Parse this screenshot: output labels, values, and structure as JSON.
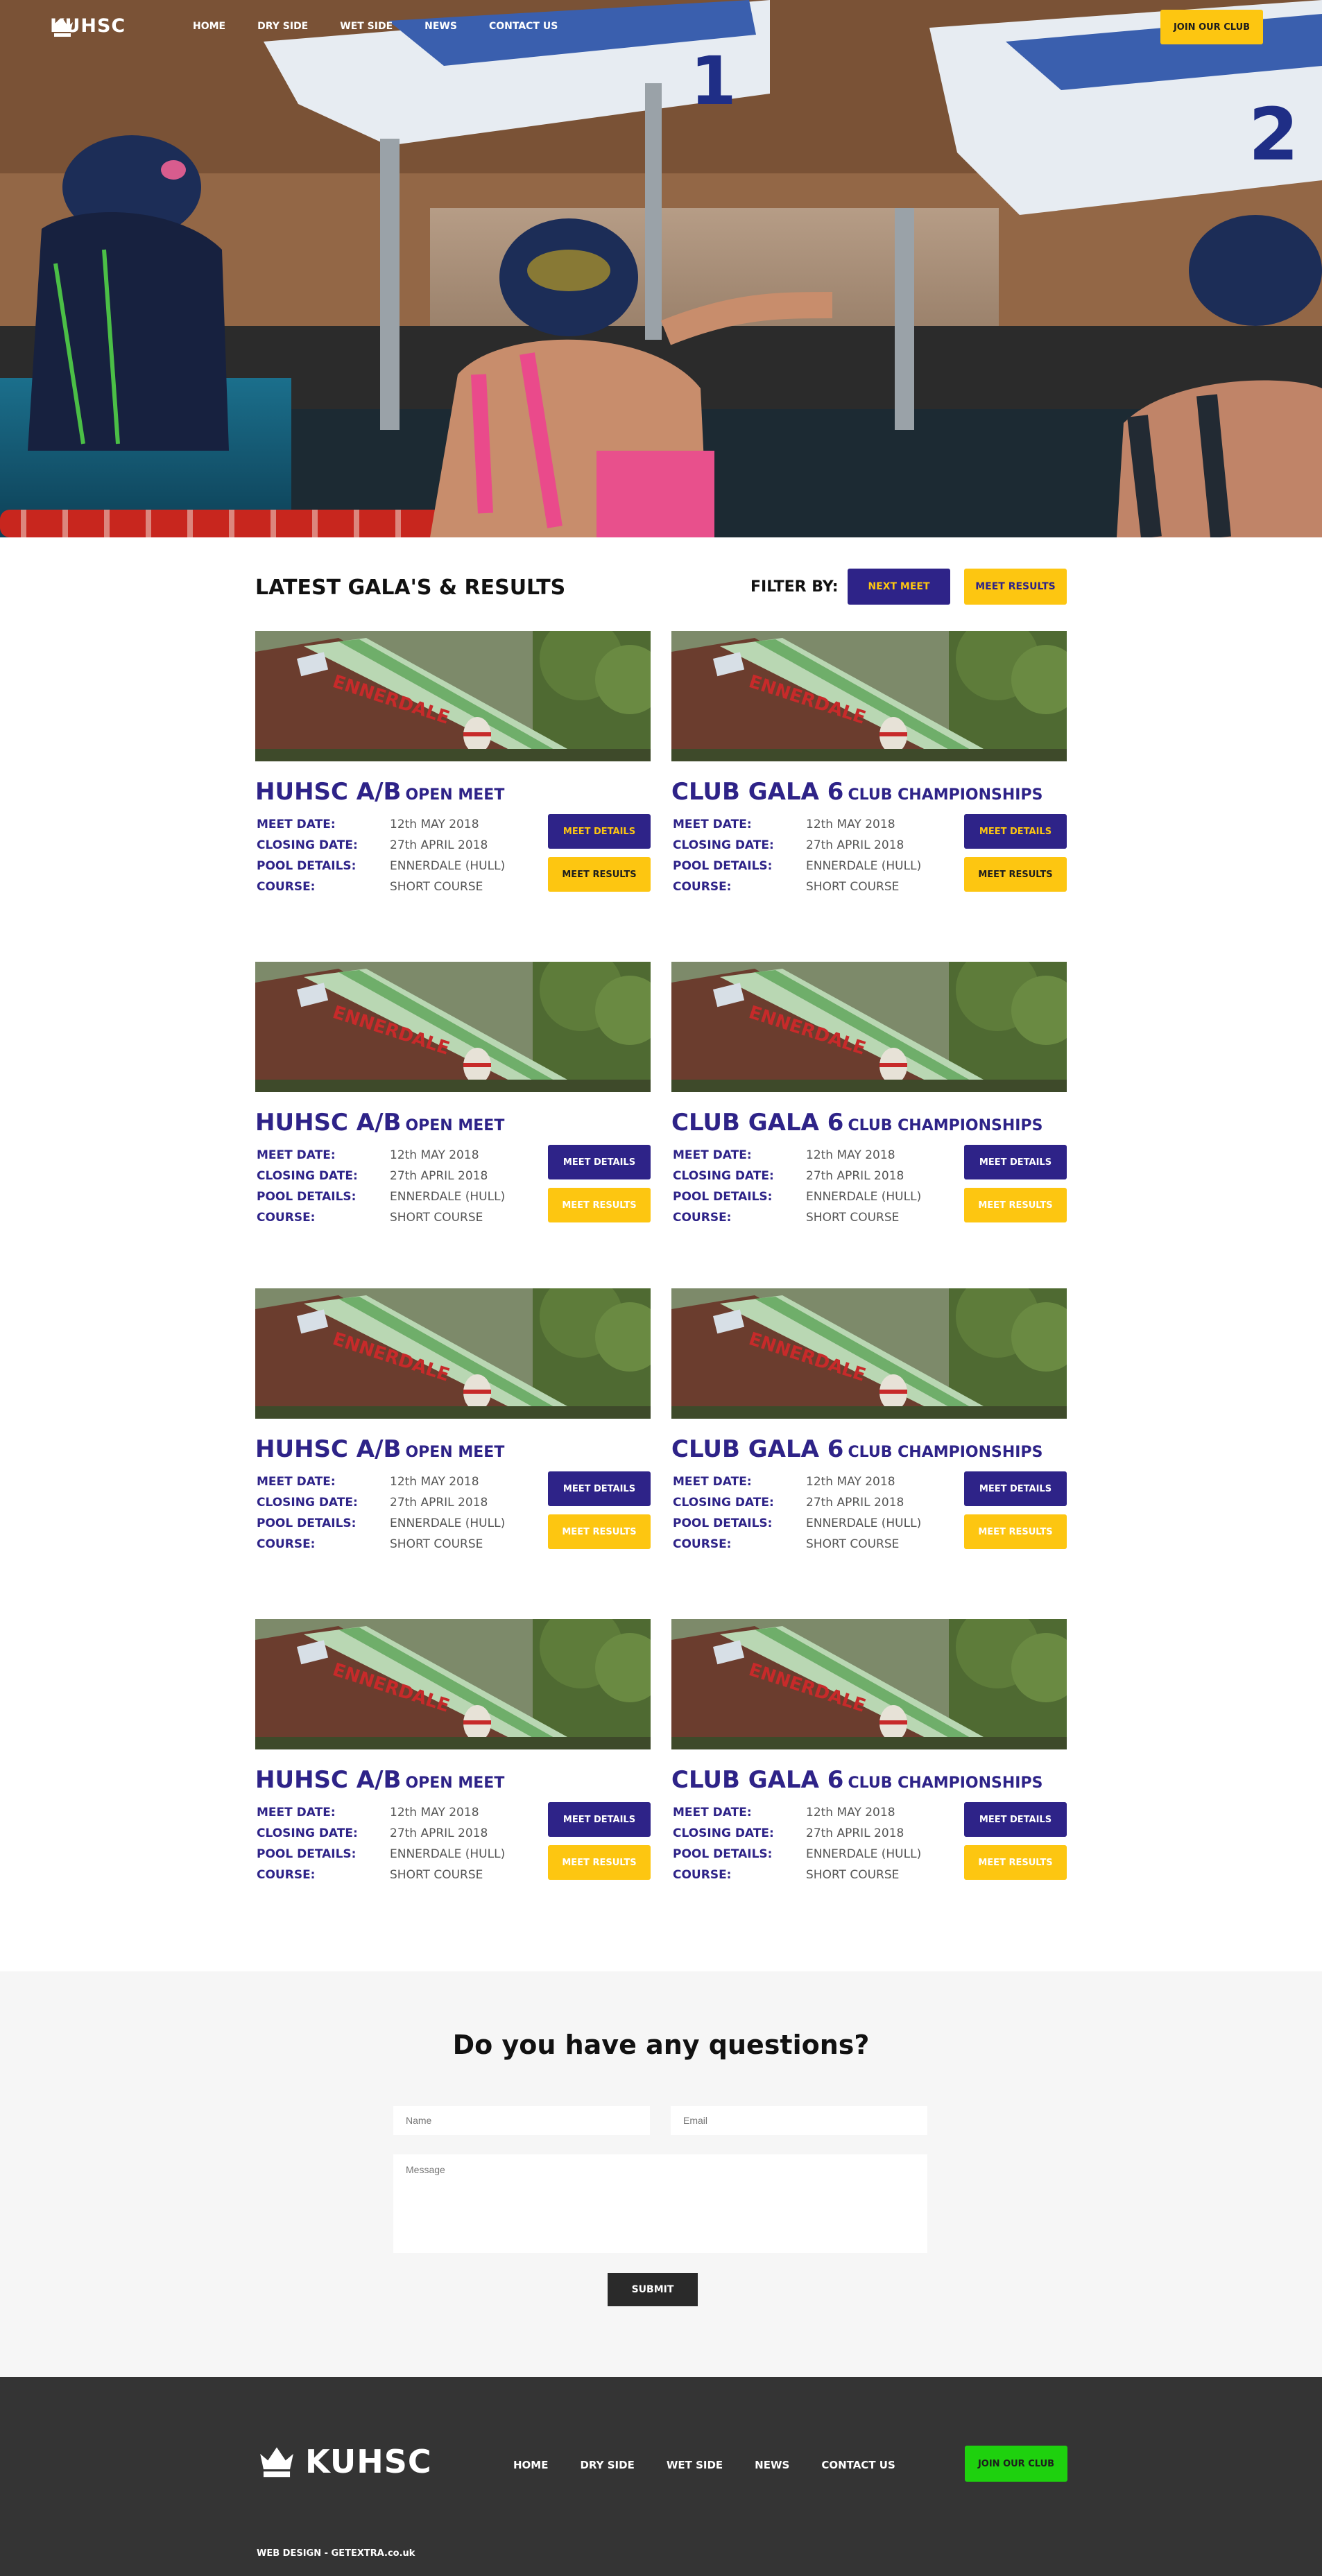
{
  "brand": {
    "name": "KUHSC"
  },
  "nav": {
    "items": [
      "HOME",
      "DRY SIDE",
      "WET SIDE",
      "NEWS",
      "CONTACT US"
    ],
    "join_label": "JOIN OUR CLUB"
  },
  "hero": {
    "lane_numbers": [
      "1",
      "2"
    ]
  },
  "gala": {
    "title": "LATEST GALA'S & RESULTS",
    "filter_label": "FILTER BY:",
    "filter_next": "NEXT MEET",
    "filter_results": "MEET RESULTS",
    "labels": {
      "meet_date": "MEET DATE:",
      "closing_date": "CLOSING DATE:",
      "pool": "POOL DETAILS:",
      "course": "COURSE:"
    },
    "details_label": "MEET DETAILS",
    "results_label": "MEET RESULTS",
    "cards": [
      {
        "title_main": "HUHSC A/B",
        "title_sub": "OPEN MEET",
        "meet_date": "12th MAY 2018",
        "closing_date": "27th APRIL 2018",
        "pool": "ENNERDALE (HULL)",
        "course": "SHORT COURSE",
        "details_text_color": "#fdc611",
        "results_text_color": "#1d1d1d"
      },
      {
        "title_main": "CLUB GALA 6",
        "title_sub": "CLUB CHAMPIONSHIPS",
        "meet_date": "12th MAY 2018",
        "closing_date": "27th APRIL 2018",
        "pool": "ENNERDALE (HULL)",
        "course": "SHORT COURSE",
        "details_text_color": "#fdc611",
        "results_text_color": "#1d1d1d"
      },
      {
        "title_main": "HUHSC A/B",
        "title_sub": "OPEN MEET",
        "meet_date": "12th MAY 2018",
        "closing_date": "27th APRIL 2018",
        "pool": "ENNERDALE (HULL)",
        "course": "SHORT COURSE",
        "details_text_color": "#ffffff",
        "results_text_color": "#ffffff"
      },
      {
        "title_main": "CLUB GALA 6",
        "title_sub": "CLUB CHAMPIONSHIPS",
        "meet_date": "12th MAY 2018",
        "closing_date": "27th APRIL 2018",
        "pool": "ENNERDALE (HULL)",
        "course": "SHORT COURSE",
        "details_text_color": "#ffffff",
        "results_text_color": "#ffffff"
      },
      {
        "title_main": "HUHSC A/B",
        "title_sub": "OPEN MEET",
        "meet_date": "12th MAY 2018",
        "closing_date": "27th APRIL 2018",
        "pool": "ENNERDALE (HULL)",
        "course": "SHORT COURSE",
        "details_text_color": "#ffffff",
        "results_text_color": "#ffffff"
      },
      {
        "title_main": "CLUB GALA 6",
        "title_sub": "CLUB CHAMPIONSHIPS",
        "meet_date": "12th MAY 2018",
        "closing_date": "27th APRIL 2018",
        "pool": "ENNERDALE (HULL)",
        "course": "SHORT COURSE",
        "details_text_color": "#ffffff",
        "results_text_color": "#ffffff"
      },
      {
        "title_main": "HUHSC A/B",
        "title_sub": "OPEN MEET",
        "meet_date": "12th MAY 2018",
        "closing_date": "27th APRIL 2018",
        "pool": "ENNERDALE (HULL)",
        "course": "SHORT COURSE",
        "details_text_color": "#ffffff",
        "results_text_color": "#ffffff"
      },
      {
        "title_main": "CLUB GALA 6",
        "title_sub": "CLUB CHAMPIONSHIPS",
        "meet_date": "12th MAY 2018",
        "closing_date": "27th APRIL 2018",
        "pool": "ENNERDALE (HULL)",
        "course": "SHORT COURSE",
        "details_text_color": "#ffffff",
        "results_text_color": "#ffffff"
      }
    ]
  },
  "questions": {
    "title": "Do you have any questions?",
    "name_placeholder": "Name",
    "email_placeholder": "Email",
    "message_placeholder": "Message",
    "submit_label": "SUBMIT"
  },
  "footer": {
    "links": [
      "HOME",
      "DRY SIDE",
      "WET SIDE",
      "NEWS",
      "CONTACT US"
    ],
    "join_label": "JOIN OUR CLUB",
    "credit": "WEB DESIGN - GETEXTRA.co.uk"
  },
  "colors": {
    "brand_purple": "#2e2388",
    "brand_yellow": "#fdc611",
    "footer_green": "#1ed10e",
    "footer_bg": "#343434"
  }
}
